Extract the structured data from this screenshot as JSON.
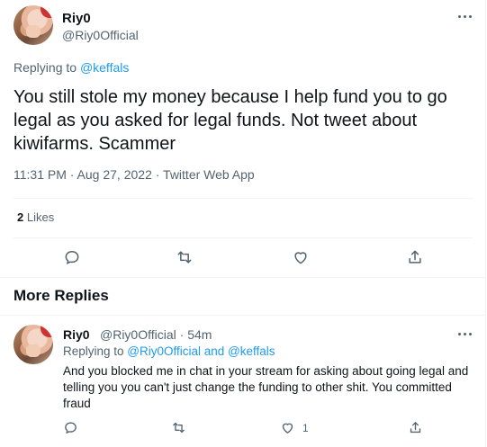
{
  "tweet": {
    "author_name": "Riy0",
    "author_handle": "@Riy0Official",
    "replying_label": "Replying to ",
    "replying_handle": "@keffals",
    "text": "You still stole my money because I help fund you to go legal as you asked for legal funds. Not tweet about kiwifarms. Scammer",
    "timestamp": "11:31 PM · Aug 27, 2022 · Twitter Web App",
    "likes_count": "2",
    "likes_label": "Likes"
  },
  "actions": {
    "reply_icon": "comment-icon",
    "retweet_icon": "retweet-icon",
    "like_icon": "heart-icon",
    "share_icon": "share-icon"
  },
  "section": {
    "title": "More Replies"
  },
  "reply": {
    "author_name": "Riy0",
    "author_handle_time": "@Riy0Official · 54m",
    "replying_label": "Replying to ",
    "replying_handles": "@Riy0Official and @keffals",
    "text": "And you blocked me in chat in your stream for asking about going legal and telling you you can't just change the funding to other shit. You committed fraud",
    "like_count": "1"
  },
  "colors": {
    "accent": "#1d9bf0",
    "muted": "#536471",
    "text": "#0f1419",
    "divider": "#eff3f4"
  }
}
